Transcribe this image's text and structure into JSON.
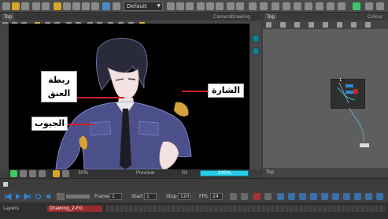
{
  "toolbar": {
    "preset": "Default"
  },
  "left_panel": {
    "tabs": [
      "Top",
      "Camera",
      "Drawing"
    ]
  },
  "annotations": {
    "tie": "ربطة\nالعنق",
    "badge": "الشارة",
    "pockets": "الجيوب"
  },
  "view_status": {
    "zoom": "30%",
    "mode": "Preview",
    "fit": "Fit",
    "progress_text": "100%",
    "progress_value": 1.0
  },
  "right_panel": {
    "tabs": [
      "Top",
      "Colour"
    ],
    "node_number": "1",
    "footer": "Top"
  },
  "timeline": {
    "frame_label": "Frame",
    "frame_value": "1",
    "start_label": "Start",
    "start_value": "1",
    "stop_label": "Stop",
    "stop_value": "120",
    "fps_label": "FPS",
    "fps_value": "24",
    "layers_label": "Layers",
    "layer_name": "Drawing_2-FG"
  },
  "colors": {
    "accent_cyan": "#15a9bf",
    "pointer_red": "#d42020",
    "layer_red": "#9b2b2b"
  }
}
